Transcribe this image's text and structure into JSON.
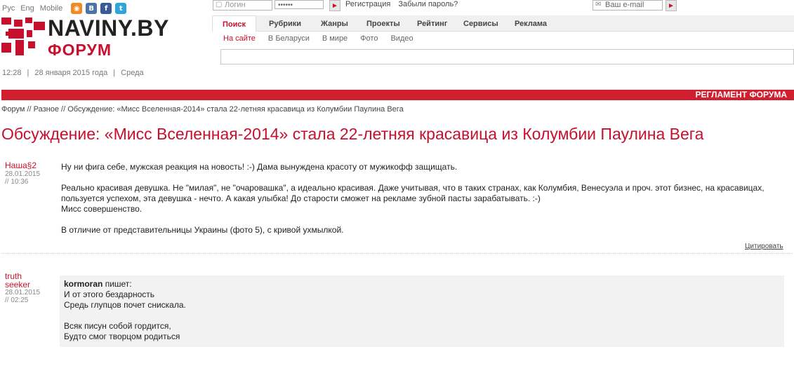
{
  "top": {
    "langs": [
      "Рус",
      "Eng",
      "Mobile"
    ],
    "social_icons": [
      "rss-icon",
      "vk-icon",
      "facebook-icon",
      "twitter-icon"
    ]
  },
  "brand": {
    "name": "NAVINY.BY",
    "section": "ФОРУМ"
  },
  "dateline": {
    "time": "12:28",
    "date": "28 января 2015 года",
    "weekday": "Среда"
  },
  "login": {
    "login_placeholder": "Логин",
    "password_value": "••••••",
    "register": "Регистрация",
    "forgot": "Забыли пароль?",
    "email_placeholder": "Ваш e-mail"
  },
  "nav": {
    "tabs": [
      "Поиск",
      "Рубрики",
      "Жанры",
      "Проекты",
      "Рейтинг",
      "Сервисы",
      "Реклама"
    ],
    "subtabs": [
      "На сайте",
      "В Беларуси",
      "В мире",
      "Фото",
      "Видео"
    ]
  },
  "bar": {
    "reglament": "РЕГЛАМЕНТ ФОРУМА"
  },
  "breadcrumbs": {
    "forum": "Форум",
    "sep": " // ",
    "section": "Разное",
    "current": "Обсуждение: «Мисс Вселенная-2014» стала 22-летняя красавица из Колумбии Паулина Вега"
  },
  "topic": {
    "prefix": "Обсуждение: ",
    "link": "«Мисс Вселенная-2014» стала 22-летняя красавица из Колумбии Паулина Вега"
  },
  "posts": [
    {
      "author": "Наша§2",
      "date": "28.01.2015",
      "time": "// 10:36",
      "lines": [
        "Ну ни фига себе, мужская реакция на новость! :-) Дама вынуждена красоту от мужикофф защищать.",
        "Реально красивая девушка. Не \"милая\", не \"очаровашка\", а идеально красивая. Даже учитывая, что в таких странах, как Колумбия, Венесуэла и проч. этот бизнес, на красавицах,",
        "пользуется успехом, эта девушка - нечто. А какая улыбка! До старости сможет на рекламе зубной пасты зарабатывать. :-)",
        "Мисс совершенство.",
        "В отличие от представительницы Украины (фото 5), с кривой ухмылкой."
      ],
      "cite": "Цитировать"
    },
    {
      "author_line1": "truth",
      "author_line2": "seeker",
      "date": "28.01.2015",
      "time": "// 02:25",
      "quote_author": "kormoran",
      "quote_verb": " пишет:",
      "quote_lines": [
        "И от этого бездарность",
        "Средь глупцов почет снискала.",
        "Всяк писун собой гордится,",
        "Будто смог творцом родиться"
      ]
    }
  ],
  "colors": {
    "accent": "#c8102e",
    "redbar": "#d01f2e"
  }
}
